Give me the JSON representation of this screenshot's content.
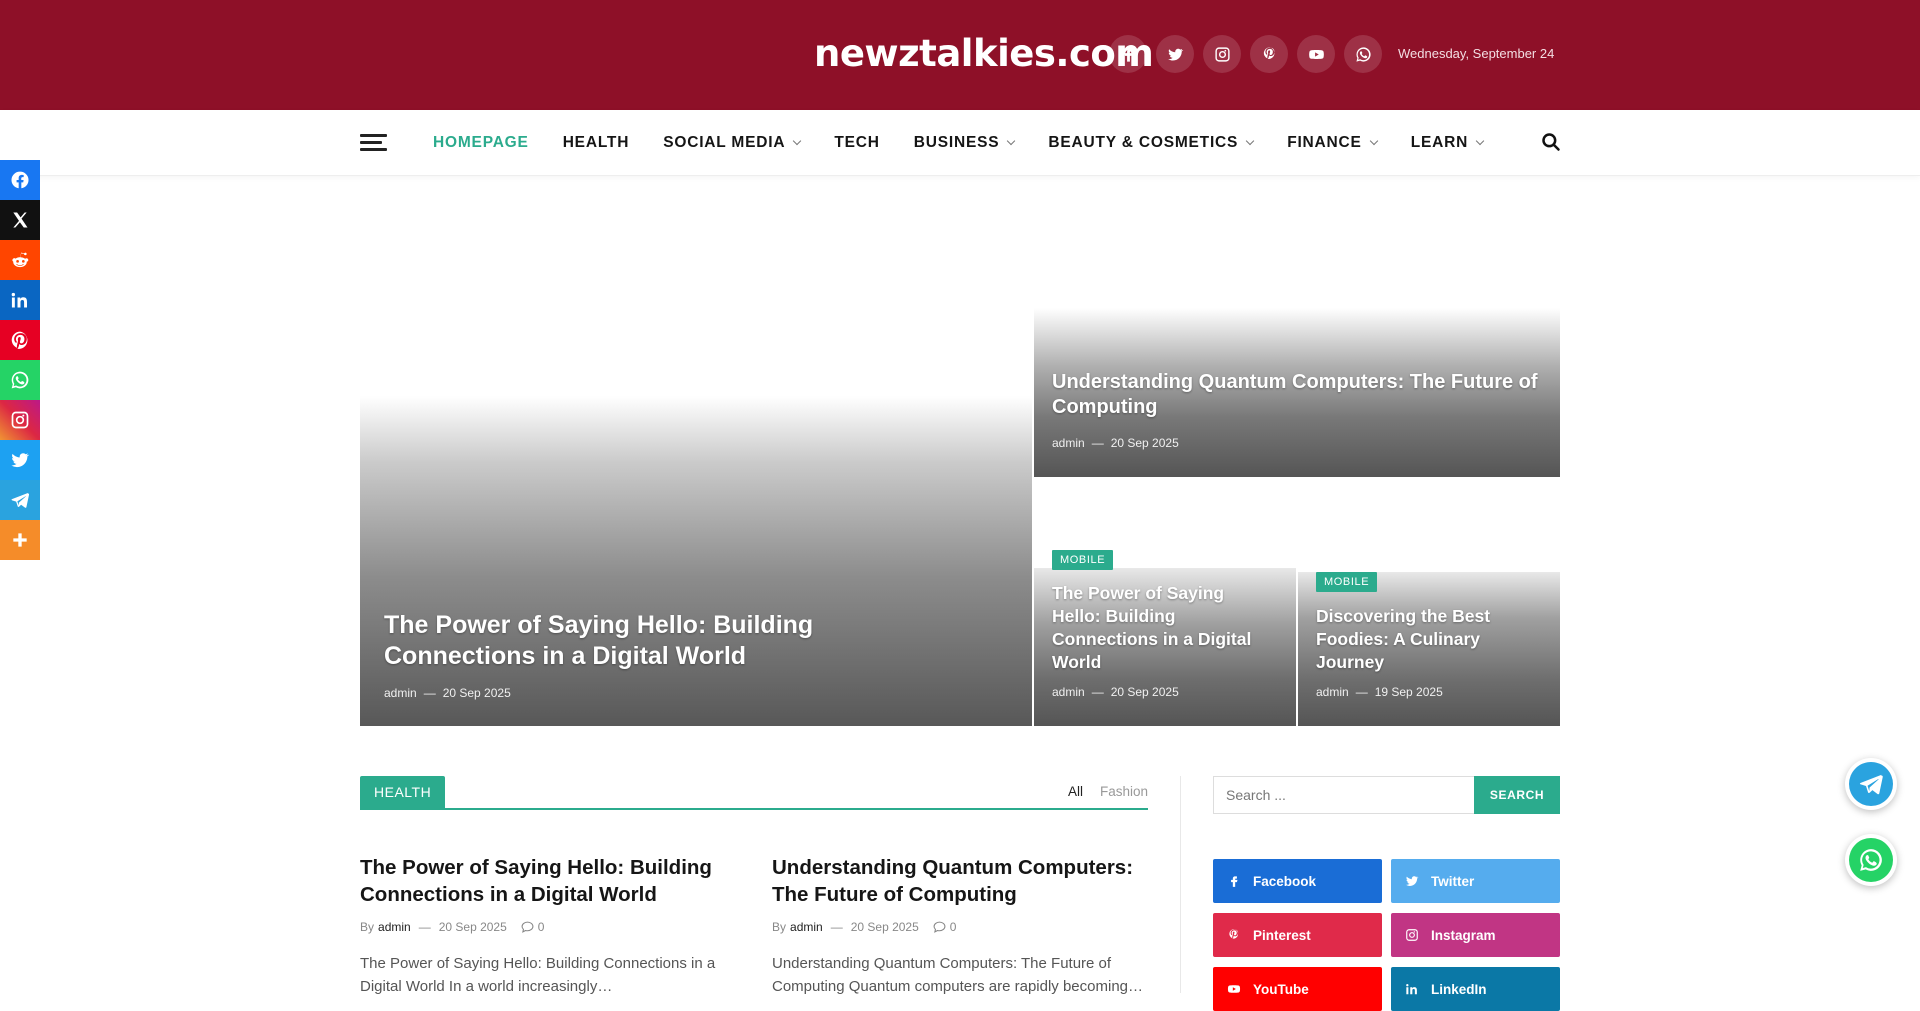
{
  "header": {
    "brand": "newztalkies.com",
    "date": "Wednesday, September 24",
    "socials": [
      {
        "name": "facebook",
        "icon": "facebook-icon"
      },
      {
        "name": "twitter",
        "icon": "twitter-icon"
      },
      {
        "name": "instagram",
        "icon": "instagram-icon"
      },
      {
        "name": "pinterest",
        "icon": "pinterest-icon"
      },
      {
        "name": "youtube",
        "icon": "youtube-icon"
      },
      {
        "name": "whatsapp",
        "icon": "whatsapp-icon"
      }
    ],
    "colors": {
      "background": "#8e1028"
    }
  },
  "nav": {
    "items": [
      {
        "label": "HOMEPAGE",
        "active": true,
        "dropdown": false
      },
      {
        "label": "HEALTH",
        "active": false,
        "dropdown": false
      },
      {
        "label": "SOCIAL MEDIA",
        "active": false,
        "dropdown": true
      },
      {
        "label": "TECH",
        "active": false,
        "dropdown": false
      },
      {
        "label": "BUSINESS",
        "active": false,
        "dropdown": true
      },
      {
        "label": "BEAUTY & COSMETICS",
        "active": false,
        "dropdown": true
      },
      {
        "label": "FINANCE",
        "active": false,
        "dropdown": true
      },
      {
        "label": "LEARN",
        "active": false,
        "dropdown": true
      }
    ],
    "accent": "#2bab8d"
  },
  "share_bar": [
    {
      "icon": "facebook-icon",
      "color": "#1877f2"
    },
    {
      "icon": "x-icon",
      "color": "#111111"
    },
    {
      "icon": "reddit-icon",
      "color": "#ff4500"
    },
    {
      "icon": "linkedin-icon",
      "color": "#0a66c2"
    },
    {
      "icon": "pinterest-icon",
      "color": "#e60023"
    },
    {
      "icon": "whatsapp-icon",
      "color": "#25d366"
    },
    {
      "icon": "instagram-icon",
      "color": "#d6249f"
    },
    {
      "icon": "twitter-icon",
      "color": "#1da1f2"
    },
    {
      "icon": "telegram-icon",
      "color": "#2aa3df"
    },
    {
      "icon": "plus-icon",
      "color": "#f58c29"
    }
  ],
  "featured": [
    {
      "title": "The Power of Saying Hello: Building Connections in a Digital World",
      "author": "admin",
      "date": "20 Sep 2025",
      "category": ""
    },
    {
      "title": "Understanding Quantum Computers: The Future of Computing",
      "author": "admin",
      "date": "20 Sep 2025",
      "category": ""
    },
    {
      "title": "The Power of Saying Hello: Building Connections in a Digital World",
      "author": "admin",
      "date": "20 Sep 2025",
      "category": "MOBILE"
    },
    {
      "title": "Discovering the Best Foodies: A Culinary Journey",
      "author": "admin",
      "date": "19 Sep 2025",
      "category": "MOBILE"
    }
  ],
  "section": {
    "label": "HEALTH",
    "tabs": [
      {
        "label": "All",
        "active": true
      },
      {
        "label": "Fashion",
        "active": false
      }
    ]
  },
  "posts": [
    {
      "title": "The Power of Saying Hello: Building Connections in a Digital World",
      "by": "By",
      "author": "admin",
      "date": "20 Sep 2025",
      "comments": "0",
      "excerpt": "The Power of Saying Hello: Building Connections in a Digital World In a world increasingly…"
    },
    {
      "title": "Understanding Quantum Computers: The Future of Computing",
      "by": "By",
      "author": "admin",
      "date": "20 Sep 2025",
      "comments": "0",
      "excerpt": "Understanding Quantum Computers: The Future of Computing Quantum computers are rapidly becoming…"
    }
  ],
  "sidebar": {
    "search_placeholder": "Search ...",
    "search_button": "SEARCH",
    "follow": [
      {
        "label": "Facebook",
        "icon": "facebook-icon",
        "color": "#1a6dd6"
      },
      {
        "label": "Twitter",
        "icon": "twitter-icon",
        "color": "#55acee"
      },
      {
        "label": "Pinterest",
        "icon": "pinterest-icon",
        "color": "#e02a4a"
      },
      {
        "label": "Instagram",
        "icon": "instagram-icon",
        "color": "#c13584"
      },
      {
        "label": "YouTube",
        "icon": "youtube-icon",
        "color": "#ff0000"
      },
      {
        "label": "LinkedIn",
        "icon": "linkedin-icon",
        "color": "#0b78a6"
      }
    ]
  },
  "floating": [
    {
      "icon": "telegram-icon",
      "color": "#2aa3df"
    },
    {
      "icon": "whatsapp-icon",
      "color": "#25d366"
    }
  ]
}
